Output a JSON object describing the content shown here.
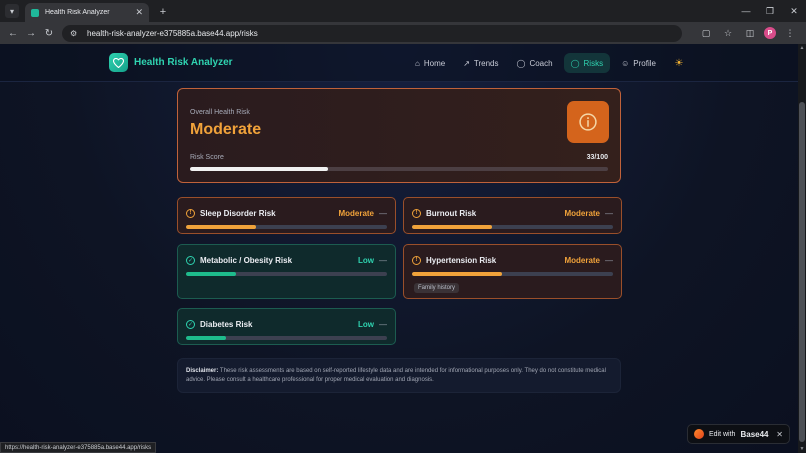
{
  "browser": {
    "tab_title": "Health Risk Analyzer",
    "url": "health-risk-analyzer-e375885a.base44.app/risks",
    "status_url": "https://health-risk-analyzer-e375885a.base44.app/risks",
    "profile_initial": "P"
  },
  "app": {
    "name": "Health Risk Analyzer",
    "nav": [
      {
        "label": "Home",
        "icon": "home-icon"
      },
      {
        "label": "Trends",
        "icon": "trend-icon"
      },
      {
        "label": "Coach",
        "icon": "chat-icon"
      },
      {
        "label": "Risks",
        "icon": "shield-icon",
        "active": true
      },
      {
        "label": "Profile",
        "icon": "user-icon"
      }
    ]
  },
  "overall": {
    "label": "Overall Health Risk",
    "level": "Moderate",
    "score_label": "Risk Score",
    "score_text": "33/100",
    "score": 33,
    "score_max": 100
  },
  "risks": [
    {
      "title": "Sleep Disorder Risk",
      "level": "Moderate",
      "fill": 0.35,
      "tag": ""
    },
    {
      "title": "Burnout Risk",
      "level": "Moderate",
      "fill": 0.4,
      "tag": ""
    },
    {
      "title": "Metabolic / Obesity Risk",
      "level": "Low",
      "fill": 0.25,
      "tag": ""
    },
    {
      "title": "Hypertension Risk",
      "level": "Moderate",
      "fill": 0.45,
      "tag": "Family history"
    },
    {
      "title": "Diabetes Risk",
      "level": "Low",
      "fill": 0.2,
      "tag": ""
    }
  ],
  "disclaimer": {
    "label": "Disclaimer:",
    "text": "These risk assessments are based on self-reported lifestyle data and are intended for informational purposes only. They do not constitute medical advice. Please consult a healthcare professional for proper medical evaluation and diagnosis."
  },
  "edit_badge": {
    "prefix": "Edit with",
    "brand": "Base44"
  },
  "colors": {
    "accent": "#2fd3b0",
    "moderate": "#f0a23a",
    "low": "#1ebc8c"
  }
}
